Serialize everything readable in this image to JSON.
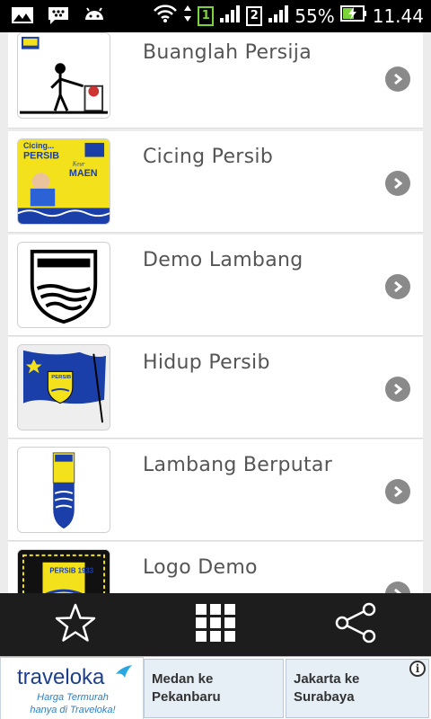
{
  "status_bar": {
    "battery": "55%",
    "time": "11.44",
    "sim1": "1",
    "sim2": "2"
  },
  "list": {
    "items": [
      {
        "title": "Buanglah Persija"
      },
      {
        "title": "Cicing Persib"
      },
      {
        "title": "Demo Lambang"
      },
      {
        "title": "Hidup Persib"
      },
      {
        "title": "Lambang Berputar"
      },
      {
        "title": "Logo Demo"
      }
    ],
    "thumb_texts": {
      "cicing_top": "Cicing...",
      "cicing_persib": "PERSIB",
      "cicing_keur": "Keur",
      "cicing_maen": "MAEN",
      "persib_small": "PERSIB",
      "persib_1933": "PERSIB 1933"
    }
  },
  "bottom_nav": {
    "favorite_icon": "star-icon",
    "grid_icon": "grid-icon",
    "share_icon": "share-icon"
  },
  "ad": {
    "brand": "traveloka",
    "tagline_1": "Harga Termurah",
    "tagline_2": "hanya di Traveloka!",
    "route1_line1": "Medan ke",
    "route1_line2": "Pekanbaru",
    "route2_line1": "Jakarta ke",
    "route2_line2": "Surabaya",
    "info": "i"
  },
  "colors": {
    "persib_blue": "#1a3fa8",
    "persib_yellow": "#f3e21b",
    "bar": "#1c1d1c",
    "ad_brand": "#1f3f8c"
  }
}
